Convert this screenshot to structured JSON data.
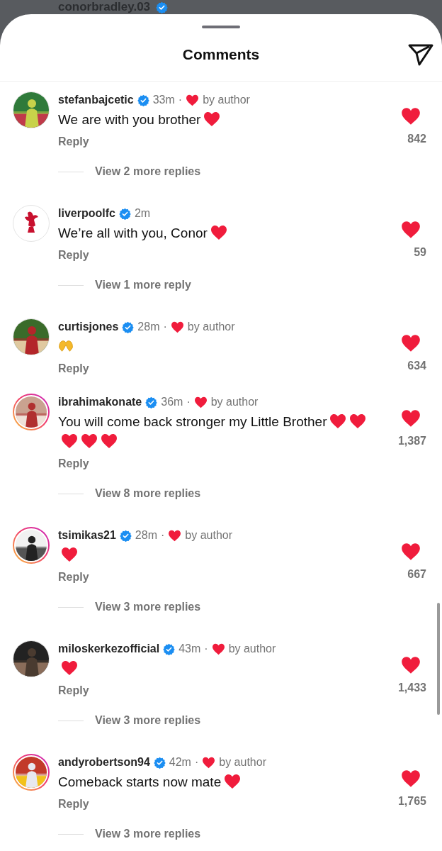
{
  "background_post": {
    "username": "conorbradley.03",
    "verified": true
  },
  "sheet": {
    "title": "Comments"
  },
  "comments": [
    {
      "username": "stefanbajcetic",
      "verified": true,
      "time": "33m",
      "separator": "·",
      "liked_by_author": true,
      "liked_by_author_label": "by author",
      "story_ring": false,
      "text": "We are with you brother",
      "emojis": [
        {
          "kind": "heart"
        }
      ],
      "reply": "Reply",
      "liked": true,
      "likes": "842",
      "more_replies": "View 2 more replies"
    },
    {
      "username": "liverpoolfc",
      "verified": true,
      "time": "2m",
      "liked_by_author": false,
      "avatar": {
        "kind": "crest"
      },
      "story_ring": false,
      "text": "We’re all with you, Conor",
      "emojis": [
        {
          "kind": "heart"
        }
      ],
      "reply": "Reply",
      "liked": true,
      "likes": "59",
      "more_replies": "View 1 more reply"
    },
    {
      "username": "curtisjones",
      "verified": true,
      "time": "28m",
      "separator": "·",
      "liked_by_author": true,
      "liked_by_author_label": "by author",
      "story_ring": false,
      "emojis": [
        {
          "kind": "heart-hands"
        }
      ],
      "reply": "Reply",
      "liked": true,
      "likes": "634"
    },
    {
      "username": "ibrahimakonate",
      "verified": true,
      "time": "36m",
      "separator": "·",
      "liked_by_author": true,
      "liked_by_author_label": "by author",
      "story_ring": true,
      "text": "You will come back stronger my Little Brother",
      "emojis": [
        {
          "kind": "heart"
        },
        {
          "kind": "heart"
        },
        {
          "kind": "heart"
        },
        {
          "kind": "heart"
        },
        {
          "kind": "heart"
        }
      ],
      "reply": "Reply",
      "liked": true,
      "likes": "1,387",
      "more_replies": "View 8 more replies"
    },
    {
      "username": "tsimikas21",
      "verified": true,
      "time": "28m",
      "separator": "·",
      "liked_by_author": true,
      "liked_by_author_label": "by author",
      "story_ring": true,
      "emojis": [
        {
          "kind": "heart"
        }
      ],
      "reply": "Reply",
      "liked": true,
      "likes": "667",
      "more_replies": "View 3 more replies"
    },
    {
      "username": "miloskerkezofficial",
      "verified": true,
      "time": "43m",
      "separator": "·",
      "liked_by_author": true,
      "liked_by_author_label": "by author",
      "story_ring": false,
      "emojis": [
        {
          "kind": "heart"
        }
      ],
      "reply": "Reply",
      "liked": true,
      "likes": "1,433",
      "more_replies": "View 3 more replies"
    },
    {
      "username": "andyrobertson94",
      "verified": true,
      "time": "42m",
      "separator": "·",
      "liked_by_author": true,
      "liked_by_author_label": "by author",
      "story_ring": true,
      "text": "Comeback starts now mate",
      "emojis": [
        {
          "kind": "heart"
        }
      ],
      "reply": "Reply",
      "liked": true,
      "likes": "1,765",
      "more_replies": "View 3 more replies"
    }
  ]
}
